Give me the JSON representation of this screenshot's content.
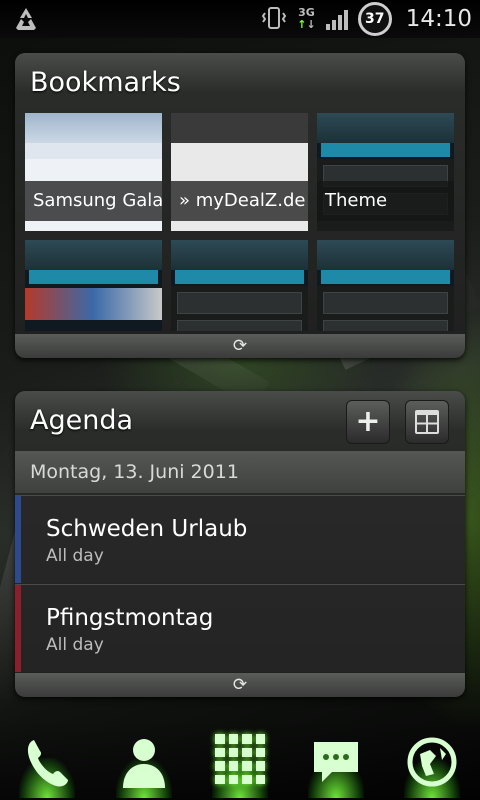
{
  "status_bar": {
    "left_icon": "recycle-icon",
    "battery_level": "37",
    "network": "3G",
    "time": "14:10"
  },
  "bookmarks": {
    "title": "Bookmarks",
    "tiles": [
      {
        "label": "Samsung Gala"
      },
      {
        "label": "» myDealZ.de"
      },
      {
        "label": "Theme"
      },
      {
        "label": ""
      },
      {
        "label": ""
      },
      {
        "label": ""
      }
    ]
  },
  "agenda": {
    "title": "Agenda",
    "date": "Montag, 13. Juni 2011",
    "events": [
      {
        "title": "Schweden Urlaub",
        "subtitle": "All day",
        "color": "#2c4a8c"
      },
      {
        "title": "Pfingstmontag",
        "subtitle": "All day",
        "color": "#8c1f2c"
      }
    ]
  },
  "dock": {
    "items": [
      "phone-icon",
      "contacts-icon",
      "app-drawer-icon",
      "messaging-icon",
      "browser-icon"
    ]
  },
  "colors": {
    "accent_green": "#7cff3c"
  }
}
